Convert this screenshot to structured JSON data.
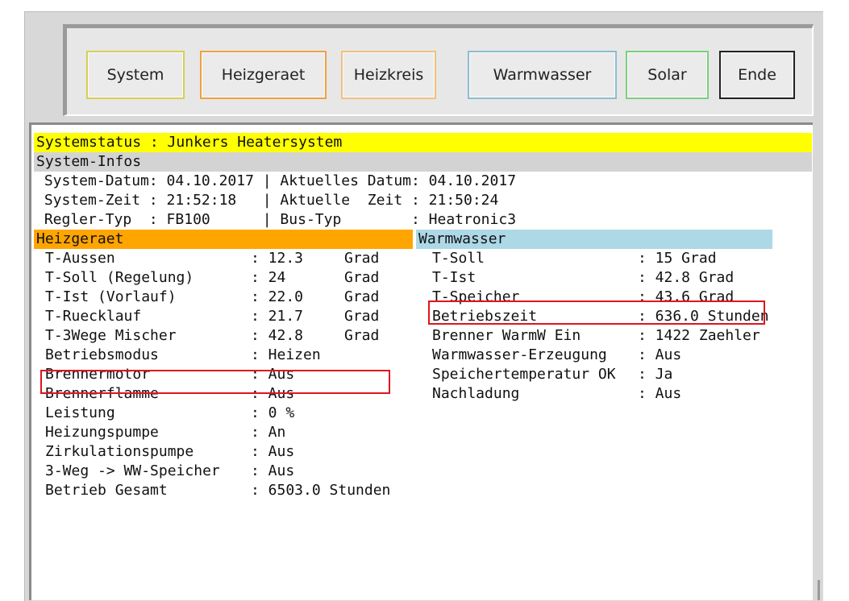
{
  "toolbar": {
    "buttons": [
      {
        "label": "System",
        "border": "#d6cf52"
      },
      {
        "label": "Heizgeraet",
        "border": "#f0a040"
      },
      {
        "label": "Heizkreis",
        "border": "#f2c080"
      },
      {
        "label": "Warmwasser",
        "border": "#8cbcd0"
      },
      {
        "label": "Solar",
        "border": "#7ccf7c"
      },
      {
        "label": "Ende",
        "border": "#222222"
      }
    ]
  },
  "status": {
    "title": "Systemstatus : Junkers Heatersystem",
    "title_color": "#ffff00",
    "infos_header": "System-Infos",
    "infos_color": "#d3d3d3",
    "infos_lines": [
      " System-Datum: 04.10.2017 | Aktuelles Datum: 04.10.2017",
      " System-Zeit : 21:52:18   | Aktuelle  Zeit : 21:50:24",
      " Regler-Typ  : FB100      | Bus-Typ        : Heatronic3"
    ]
  },
  "heizgeraet": {
    "header": "Heizgeraet",
    "color": "#ffa500",
    "rows": [
      {
        "name": "T-Aussen",
        "value": ": 12.3",
        "unit": "Grad"
      },
      {
        "name": "T-Soll (Regelung)",
        "value": ": 24",
        "unit": "Grad"
      },
      {
        "name": "T-Ist (Vorlauf)",
        "value": ": 22.0",
        "unit": "Grad"
      },
      {
        "name": "T-Ruecklauf",
        "value": ": 21.7",
        "unit": "Grad"
      },
      {
        "name": "T-3Wege Mischer",
        "value": ": 42.8",
        "unit": "Grad"
      },
      {
        "name": "Betriebsmodus",
        "value": ": Heizen",
        "unit": ""
      },
      {
        "name": "Brennermotor",
        "value": ": Aus",
        "unit": ""
      },
      {
        "name": "Brennerflamme",
        "value": ": Aus",
        "unit": ""
      },
      {
        "name": "Leistung",
        "value": ": 0 %",
        "unit": ""
      },
      {
        "name": "Heizungspumpe",
        "value": ": An",
        "unit": ""
      },
      {
        "name": "Zirkulationspumpe",
        "value": ": Aus",
        "unit": ""
      },
      {
        "name": "3-Weg -> WW-Speicher",
        "value": ": Aus",
        "unit": ""
      },
      {
        "name": "Betrieb Gesamt",
        "value": ": 6503.0 Stunden",
        "unit": ""
      }
    ]
  },
  "warmwasser": {
    "header": "Warmwasser",
    "color": "#add8e6",
    "rows": [
      {
        "name": "T-Soll",
        "value": ": 15 Grad"
      },
      {
        "name": "T-Ist",
        "value": ": 42.8 Grad"
      },
      {
        "name": "T-Speicher",
        "value": ": 43.6 Grad"
      },
      {
        "name": "Betriebszeit",
        "value": ": 636.0 Stunden"
      },
      {
        "name": "Brenner WarmW Ein",
        "value": ": 1422 Zaehler"
      },
      {
        "name": "Warmwasser-Erzeugung",
        "value": ": Aus"
      },
      {
        "name": "Speichertemperatur OK",
        "value": ": Ja"
      },
      {
        "name": "Nachladung",
        "value": ": Aus"
      }
    ]
  }
}
